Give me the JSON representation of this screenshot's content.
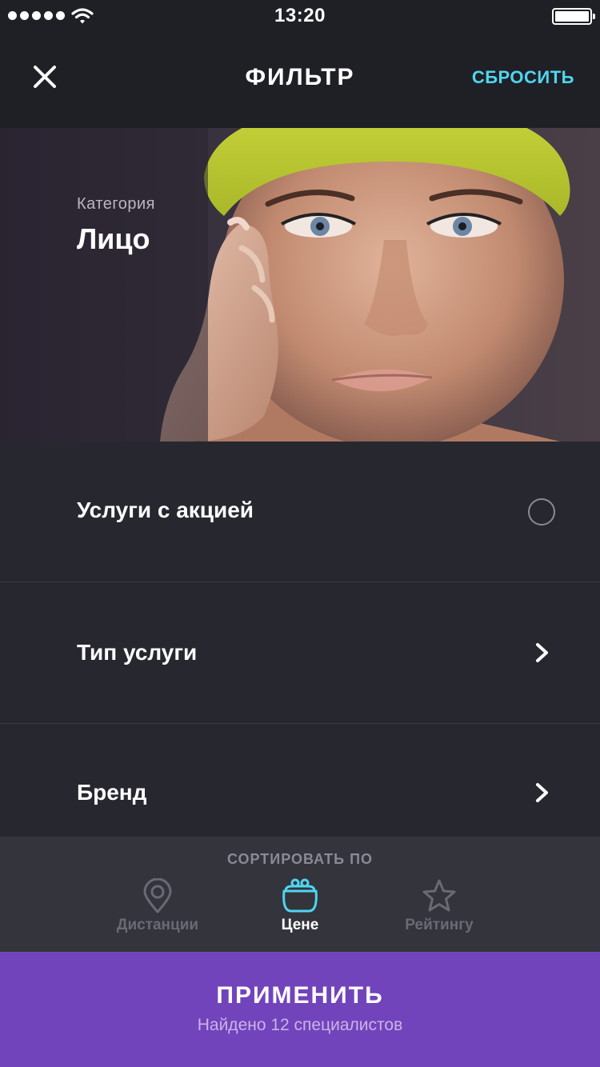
{
  "status_bar": {
    "time": "13:20"
  },
  "nav": {
    "title": "ФИЛЬТР",
    "reset_label": "СБРОСИТЬ"
  },
  "hero": {
    "category_label": "Категория",
    "category_value": "Лицо"
  },
  "rows": [
    {
      "label": "Услуги с акцией",
      "control": "radio"
    },
    {
      "label": "Тип услуги",
      "control": "chevron"
    },
    {
      "label": "Бренд",
      "control": "chevron"
    }
  ],
  "sort": {
    "title": "СОРТИРОВАТЬ ПО",
    "options": [
      {
        "label": "Дистанции",
        "icon": "location-pin-icon",
        "selected": false
      },
      {
        "label": "Цене",
        "icon": "purse-icon",
        "selected": true
      },
      {
        "label": "Рейтингу",
        "icon": "star-icon",
        "selected": false
      }
    ]
  },
  "apply": {
    "title": "ПРИМЕНИТЬ",
    "subtitle": "Найдено 12 специалистов"
  },
  "colors": {
    "accent": "#4fd6f0",
    "apply_bg": "#7244bb",
    "background": "#272730",
    "bar_bg": "#1f2026",
    "inactive": "#6a6a74"
  }
}
